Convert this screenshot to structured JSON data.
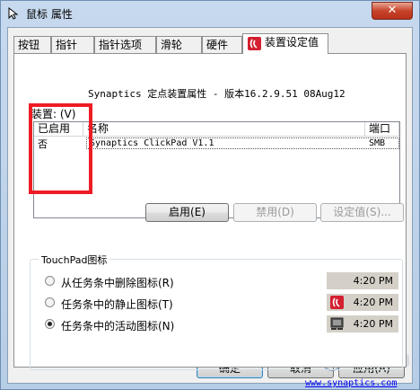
{
  "window": {
    "title": "鼠标 属性",
    "close_label": "✕"
  },
  "tabs": [
    {
      "label": "按钮"
    },
    {
      "label": "指针"
    },
    {
      "label": "指针选项"
    },
    {
      "label": "滑轮"
    },
    {
      "label": "硬件"
    },
    {
      "label": "装置设定值",
      "active": true
    }
  ],
  "panel": {
    "device_header": "Synaptics 定点装置属性 - 版本16.2.9.51 08Aug12",
    "devices_label": "装置: (V)",
    "columns": [
      "已启用",
      "名称",
      "端口"
    ],
    "rows": [
      {
        "enabled": "否",
        "name": "Synaptics ClickPad V1.1",
        "port": "SMB"
      }
    ],
    "buttons": {
      "enable": "启用(E)",
      "disable": "禁用(D)",
      "settings": "设定值(S)..."
    },
    "touchpad_group": {
      "label": "TouchPad图标",
      "options": [
        {
          "label": "从任务条中删除图标(R)",
          "checked": false,
          "preview_time": "4:20 PM",
          "preview_icon": "none"
        },
        {
          "label": "任务条中的静止图标(T)",
          "checked": false,
          "preview_time": "4:20 PM",
          "preview_icon": "synaptics-static-icon"
        },
        {
          "label": "任务条中的活动图标(N)",
          "checked": true,
          "preview_time": "4:20 PM",
          "preview_icon": "touchpad-animated-icon"
        }
      ]
    },
    "link": "www.synaptics.com"
  },
  "footer": {
    "ok": "确定",
    "cancel": "取消",
    "apply": "应用(A)"
  },
  "colors": {
    "highlight_box": "#ee1c25",
    "synaptics_red": "#d42030",
    "link": "#0000ee"
  }
}
